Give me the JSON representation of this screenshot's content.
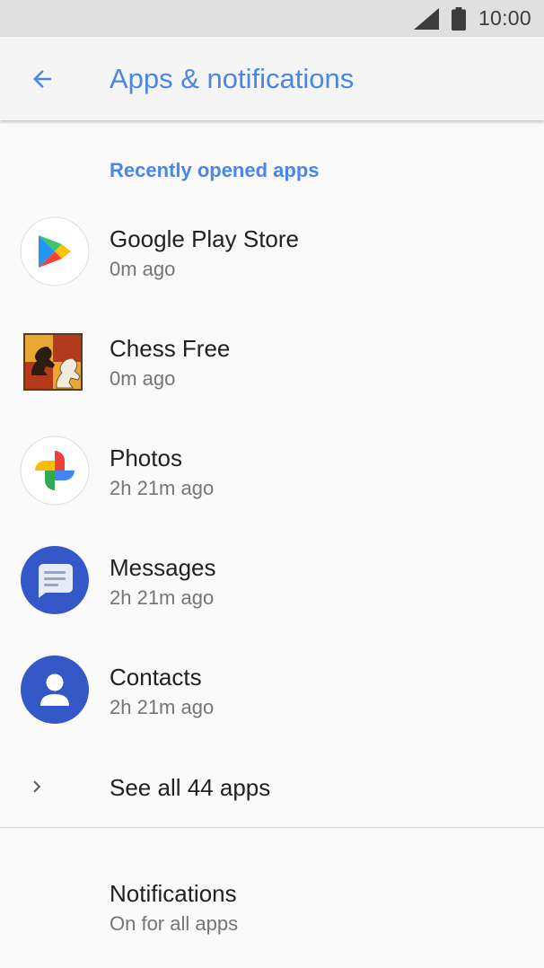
{
  "status_bar": {
    "time": "10:00",
    "icons": [
      "cell-signal-icon",
      "battery-icon"
    ]
  },
  "app_bar": {
    "back_icon": "arrow-back-icon",
    "title": "Apps & notifications"
  },
  "recent_apps": {
    "header": "Recently opened apps",
    "items": [
      {
        "name": "Google Play Store",
        "time": "0m ago",
        "icon": "google-play-store-icon"
      },
      {
        "name": "Chess Free",
        "time": "0m ago",
        "icon": "chess-free-icon"
      },
      {
        "name": "Photos",
        "time": "2h 21m ago",
        "icon": "google-photos-icon"
      },
      {
        "name": "Messages",
        "time": "2h 21m ago",
        "icon": "messages-icon"
      },
      {
        "name": "Contacts",
        "time": "2h 21m ago",
        "icon": "contacts-icon"
      }
    ],
    "see_all": {
      "label": "See all 44 apps",
      "icon": "chevron-right-icon"
    }
  },
  "notifications": {
    "title": "Notifications",
    "summary": "On for all apps"
  },
  "colors": {
    "accent": "#4a86e8",
    "status_bar": "#e0e0e0",
    "app_bar": "#f5f5f5",
    "background": "#fafafa",
    "primary_text": "#212121",
    "secondary_text": "#757575",
    "messages_blue": "#3458c8",
    "contacts_blue": "#3458c8"
  }
}
